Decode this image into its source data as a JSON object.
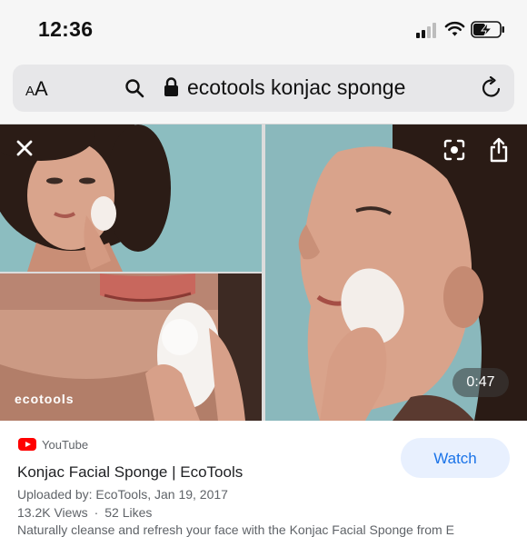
{
  "status_bar": {
    "time": "12:36",
    "icons": [
      "cellular-signal-icon",
      "wifi-icon",
      "battery-charging-icon"
    ],
    "battery_color": "#111111"
  },
  "browser": {
    "text_size_label": "AA",
    "url": "ecotools konjac sponge",
    "icons": [
      "search-icon",
      "lock-icon",
      "reload-icon"
    ]
  },
  "video": {
    "brand_watermark": "ecotools",
    "duration": "0:47",
    "controls": [
      "close-icon",
      "lens-icon",
      "share-icon"
    ]
  },
  "result": {
    "source": "YouTube",
    "title": "Konjac Facial Sponge | EcoTools",
    "uploaded": "Uploaded by: EcoTools, Jan 19, 2017",
    "views": "13.2K Views",
    "separator": "·",
    "likes": "52 Likes",
    "watch_label": "Watch",
    "truncated_description": "Naturally cleanse and refresh your face with the Konjac Facial Sponge from E"
  },
  "colors": {
    "accent": "#1a73e8",
    "watch_bg": "#e8f0fe",
    "youtube_red": "#ff0000"
  }
}
